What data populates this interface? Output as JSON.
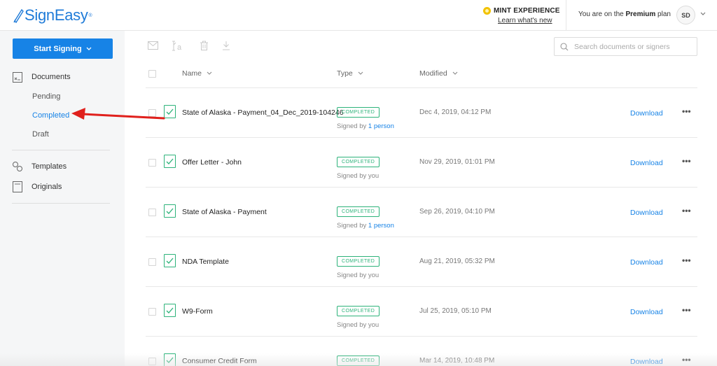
{
  "header": {
    "logo": "SignEasy",
    "logo_mark": "®",
    "mint_title": "MINT EXPERIENCE",
    "mint_link": "Learn what's new",
    "plan_prefix": "You are on the",
    "plan_name": "Premium",
    "plan_suffix": "plan",
    "avatar": "SD"
  },
  "sidebar": {
    "start_signing": "Start Signing",
    "documents": "Documents",
    "sub_items": [
      "Pending",
      "Completed",
      "Draft"
    ],
    "active_sub": "Completed",
    "templates": "Templates",
    "originals": "Originals"
  },
  "search": {
    "placeholder": "Search documents or signers"
  },
  "table": {
    "headers": {
      "name": "Name",
      "type": "Type",
      "modified": "Modified"
    },
    "rows": [
      {
        "name": "State of Alaska - Payment_04_Dec_2019-104246",
        "status": "COMPLETED",
        "signed_prefix": "Signed by ",
        "signed_who": "1 person",
        "modified": "Dec 4, 2019, 04:12 PM",
        "action": "Download"
      },
      {
        "name": "Offer Letter - John",
        "status": "COMPLETED",
        "signed_prefix": "Signed by you",
        "signed_who": "",
        "modified": "Nov 29, 2019, 01:01 PM",
        "action": "Download"
      },
      {
        "name": "State of Alaska - Payment",
        "status": "COMPLETED",
        "signed_prefix": "Signed by ",
        "signed_who": "1 person",
        "modified": "Sep 26, 2019, 04:10 PM",
        "action": "Download"
      },
      {
        "name": "NDA Template",
        "status": "COMPLETED",
        "signed_prefix": "Signed by you",
        "signed_who": "",
        "modified": "Aug 21, 2019, 05:32 PM",
        "action": "Download"
      },
      {
        "name": "W9-Form",
        "status": "COMPLETED",
        "signed_prefix": "Signed by you",
        "signed_who": "",
        "modified": "Jul 25, 2019, 05:10 PM",
        "action": "Download"
      },
      {
        "name": "Consumer Credit Form",
        "status": "COMPLETED",
        "signed_prefix": "",
        "signed_who": "",
        "modified": "Mar 14, 2019, 10:48 PM",
        "action": "Download"
      }
    ],
    "more_label": "•••"
  },
  "colors": {
    "brand_blue": "#1783e6",
    "completed_green": "#2db37a",
    "annotation_red": "#e0201c",
    "mint_gold": "#f2c200"
  },
  "icons": [
    "pen-nib-icon",
    "mail-icon",
    "rename-icon",
    "trash-icon",
    "download-icon",
    "search-icon",
    "documents-icon",
    "templates-icon",
    "originals-icon",
    "document-check-icon",
    "chevron-down-icon",
    "more-icon"
  ]
}
